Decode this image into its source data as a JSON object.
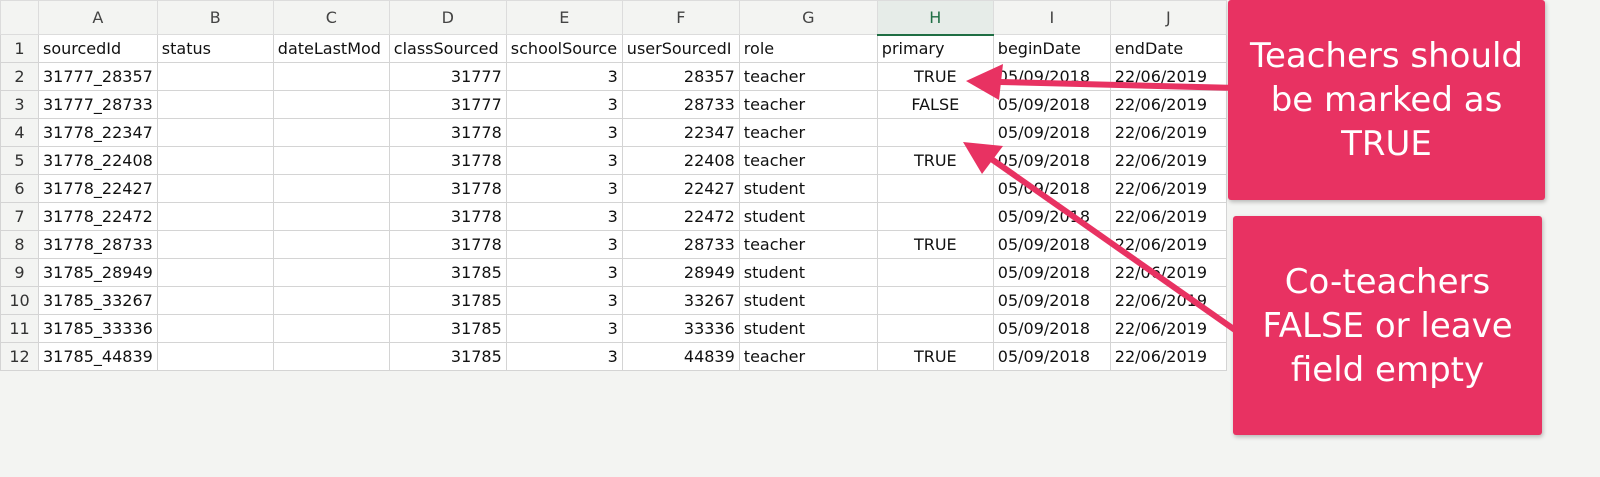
{
  "spreadsheet": {
    "column_letters": [
      "A",
      "B",
      "C",
      "D",
      "E",
      "F",
      "G",
      "H",
      "I",
      "J"
    ],
    "selected_column": "H",
    "row_numbers": [
      "1",
      "2",
      "3",
      "4",
      "5",
      "6",
      "7",
      "8",
      "9",
      "10",
      "11",
      "12"
    ],
    "headers": [
      "sourcedId",
      "status",
      "dateLastMod",
      "classSourced",
      "schoolSource",
      "userSourcedI",
      "role",
      "primary",
      "beginDate",
      "endDate"
    ],
    "rows": [
      [
        "31777_28357",
        "",
        "",
        "31777",
        "3",
        "28357",
        "teacher",
        "TRUE",
        "05/09/2018",
        "22/06/2019"
      ],
      [
        "31777_28733",
        "",
        "",
        "31777",
        "3",
        "28733",
        "teacher",
        "FALSE",
        "05/09/2018",
        "22/06/2019"
      ],
      [
        "31778_22347",
        "",
        "",
        "31778",
        "3",
        "22347",
        "teacher",
        "",
        "05/09/2018",
        "22/06/2019"
      ],
      [
        "31778_22408",
        "",
        "",
        "31778",
        "3",
        "22408",
        "teacher",
        "TRUE",
        "05/09/2018",
        "22/06/2019"
      ],
      [
        "31778_22427",
        "",
        "",
        "31778",
        "3",
        "22427",
        "student",
        "",
        "05/09/2018",
        "22/06/2019"
      ],
      [
        "31778_22472",
        "",
        "",
        "31778",
        "3",
        "22472",
        "student",
        "",
        "05/09/2018",
        "22/06/2019"
      ],
      [
        "31778_28733",
        "",
        "",
        "31778",
        "3",
        "28733",
        "teacher",
        "TRUE",
        "05/09/2018",
        "22/06/2019"
      ],
      [
        "31785_28949",
        "",
        "",
        "31785",
        "3",
        "28949",
        "student",
        "",
        "05/09/2018",
        "22/06/2019"
      ],
      [
        "31785_33267",
        "",
        "",
        "31785",
        "3",
        "33267",
        "student",
        "",
        "05/09/2018",
        "22/06/2019"
      ],
      [
        "31785_33336",
        "",
        "",
        "31785",
        "3",
        "33336",
        "student",
        "",
        "05/09/2018",
        "22/06/2019"
      ],
      [
        "31785_44839",
        "",
        "",
        "31785",
        "3",
        "44839",
        "teacher",
        "TRUE",
        "05/09/2018",
        "22/06/2019"
      ]
    ]
  },
  "callouts": [
    {
      "lines": [
        "Teachers should",
        "be marked as",
        "TRUE"
      ]
    },
    {
      "lines": [
        "Co-teachers",
        "FALSE or leave",
        "field empty"
      ]
    }
  ],
  "colors": {
    "callout_bg": "#e83262",
    "arrow": "#e83262",
    "selected_column": "#1f6e43"
  },
  "icons": {
    "arrows": "arrow-icon"
  }
}
